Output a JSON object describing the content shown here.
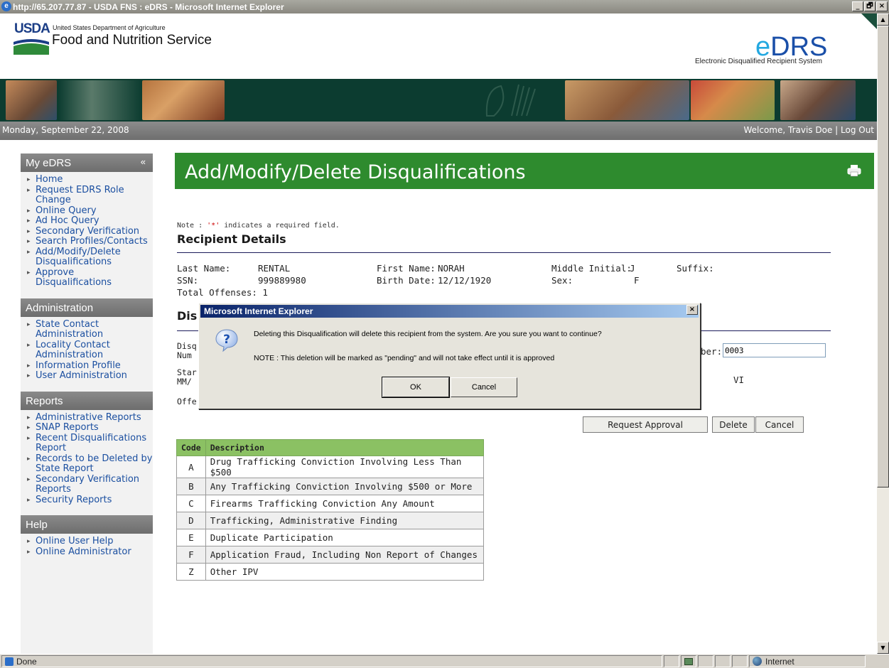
{
  "window": {
    "title": "http://65.207.77.87 - USDA FNS : eDRS - Microsoft Internet Explorer",
    "minimize": "_",
    "restore": "🗗",
    "close": "×"
  },
  "header": {
    "usda": "USDA",
    "department": "United States Department of Agriculture",
    "agency": "Food and Nutrition Service",
    "logo_e": "e",
    "logo_drs": "DRS",
    "logo_subtitle": "Electronic Disqualified Recipient System"
  },
  "datebar": {
    "date": "Monday, September 22, 2008",
    "welcome": "Welcome, Travis Doe | Log Out"
  },
  "sidebar": {
    "my_edrs": {
      "title": "My eDRS",
      "collapse": "«",
      "items": [
        {
          "label": "Home"
        },
        {
          "label": "Request EDRS Role Change"
        },
        {
          "label": "Online Query"
        },
        {
          "label": "Ad Hoc Query"
        },
        {
          "label": "Secondary Verification"
        },
        {
          "label": "Search Profiles/Contacts"
        },
        {
          "label": "Add/Modify/Delete Disqualifications"
        },
        {
          "label": "Approve Disqualifications"
        }
      ]
    },
    "administration": {
      "title": "Administration",
      "items": [
        {
          "label": "State Contact Administration"
        },
        {
          "label": "Locality Contact Administration"
        },
        {
          "label": "Information Profile"
        },
        {
          "label": "User Administration"
        }
      ]
    },
    "reports": {
      "title": "Reports",
      "items": [
        {
          "label": "Administrative Reports"
        },
        {
          "label": "SNAP Reports"
        },
        {
          "label": "Recent Disqualifications Report"
        },
        {
          "label": "Records to be Deleted by State Report"
        },
        {
          "label": "Secondary Verification Reports"
        },
        {
          "label": "Security Reports"
        }
      ]
    },
    "help": {
      "title": "Help",
      "items": [
        {
          "label": "Online User Help"
        },
        {
          "label": "Online Administrator"
        }
      ]
    }
  },
  "main": {
    "page_title": "Add/Modify/Delete Disqualifications",
    "note_prefix": "Note : ",
    "note_star": "'*'",
    "note_suffix": " indicates a required field.",
    "recipient_heading": "Recipient Details",
    "recipient": {
      "last_name_label": "Last Name:",
      "last_name": "RENTAL",
      "first_name_label": "First Name:",
      "first_name": "NORAH",
      "middle_initial_label": "Middle Initial:",
      "middle_initial": "J",
      "suffix_label": "Suffix:",
      "ssn_label": "SSN:",
      "ssn": "999889980",
      "birth_date_label": "Birth Date:",
      "birth_date": "12/12/1920",
      "sex_label": "Sex:",
      "sex": "F",
      "total_offenses_label": "Total Offenses:",
      "total_offenses": "1"
    },
    "disq_heading_partial": "Dis",
    "disq_num_label_a": "Disq",
    "disq_num_label_b": "Num",
    "start_label_a": "Star",
    "start_label_b": "MM/",
    "offense_label": "Offe",
    "number_label_partial": "ber:",
    "number_value": "0003",
    "state_value": "VI",
    "buttons": {
      "request_approval": "Request Approval",
      "delete": "Delete",
      "cancel": "Cancel"
    },
    "codes_table": {
      "headers": [
        "Code",
        "Description"
      ],
      "rows": [
        {
          "code": "A",
          "description": "Drug Trafficking Conviction Involving Less Than $500"
        },
        {
          "code": "B",
          "description": "Any Trafficking Conviction Involving $500 or More"
        },
        {
          "code": "C",
          "description": "Firearms Trafficking Conviction Any Amount"
        },
        {
          "code": "D",
          "description": "Trafficking, Administrative Finding"
        },
        {
          "code": "E",
          "description": "Duplicate Participation"
        },
        {
          "code": "F",
          "description": "Application Fraud, Including Non Report of Changes"
        },
        {
          "code": "Z",
          "description": "Other IPV"
        }
      ]
    }
  },
  "dialog": {
    "title": "Microsoft Internet Explorer",
    "close": "×",
    "icon": "question-icon",
    "message": "Deleting this Disqualification will delete this recipient from the system. Are you sure you want to continue?",
    "note": "NOTE : This deletion will be marked as \"pending\" and will not take effect until it is approved",
    "ok": "OK",
    "cancel": "Cancel"
  },
  "statusbar": {
    "text": "Done",
    "zone": "Internet"
  }
}
